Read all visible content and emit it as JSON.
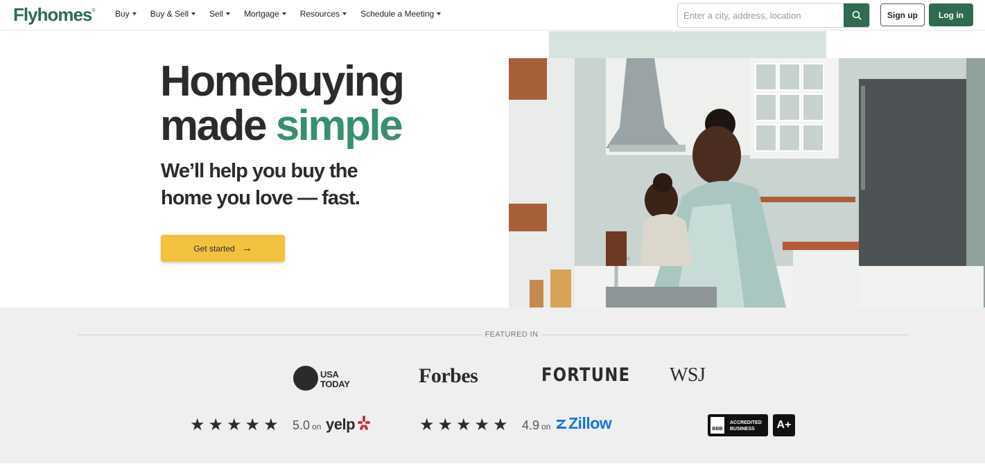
{
  "nav": {
    "logo": "Flyhomes",
    "logo_mark": "®",
    "menu": [
      {
        "label": "Buy"
      },
      {
        "label": "Buy & Sell"
      },
      {
        "label": "Sell"
      },
      {
        "label": "Mortgage"
      },
      {
        "label": "Resources"
      },
      {
        "label": "Schedule a Meeting"
      }
    ],
    "search_placeholder": "Enter a city, address, location",
    "signup_label": "Sign up",
    "login_label": "Log in"
  },
  "hero": {
    "title_line1": "Homebuying",
    "title_line2_a": "made ",
    "title_line2_b": "simple",
    "subtitle": "We’ll help you buy the home you love — fast.",
    "cta_label": "Get started"
  },
  "featured": {
    "label": "FEATURED IN",
    "outlets": {
      "usa_today_line1": "USA",
      "usa_today_line2": "TODAY",
      "forbes": "Forbes",
      "fortune": "FORTUNE",
      "wsj": "WSJ"
    },
    "ratings": {
      "yelp": {
        "stars": "★★★★★",
        "score": "5.0",
        "on": "on",
        "brand": "yelp"
      },
      "zillow": {
        "stars": "★★★★★",
        "score": "4.9",
        "on": "on",
        "brand": "Zillow"
      },
      "bbb": {
        "mark": "BBB",
        "line1": "ACCREDITED",
        "line2": "BUSINESS",
        "grade": "A+"
      }
    }
  },
  "colors": {
    "brand_green": "#2f6b4f",
    "accent_green": "#3a8f6e",
    "cta_yellow": "#f2c23f",
    "zillow_blue": "#1277e1",
    "yelp_red": "#c8332a"
  }
}
